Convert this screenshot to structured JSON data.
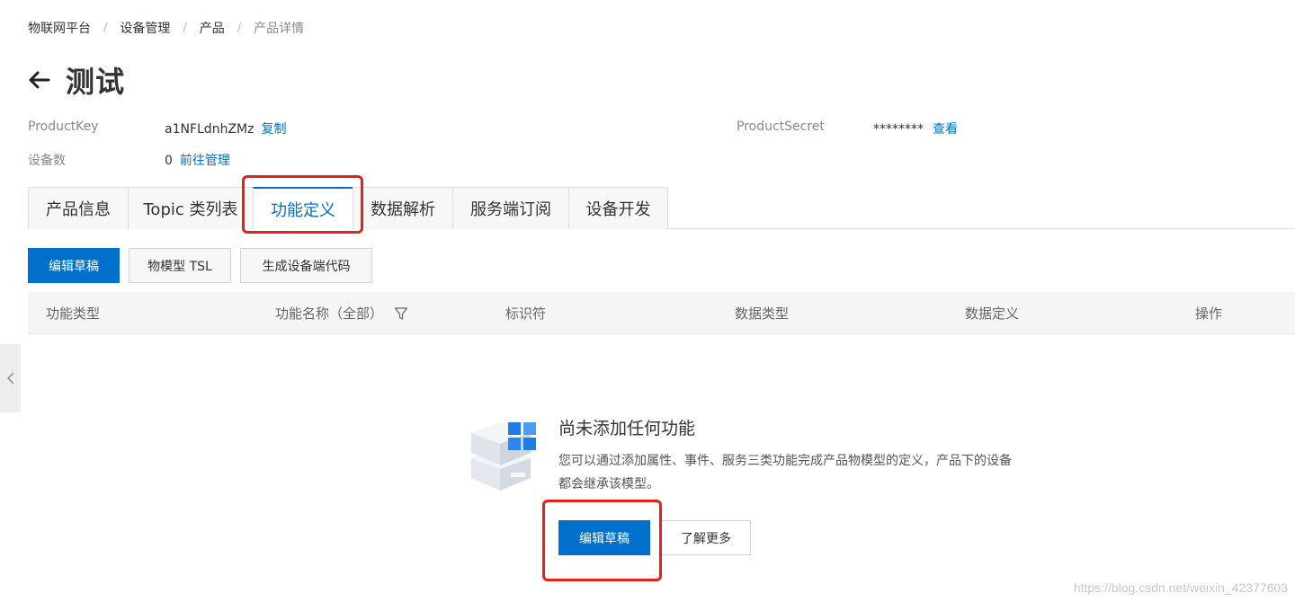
{
  "breadcrumb": {
    "items": [
      "物联网平台",
      "设备管理",
      "产品"
    ],
    "current": "产品详情",
    "separator": "/"
  },
  "header": {
    "title": "测试",
    "back_icon": "arrow-left-icon"
  },
  "meta": {
    "product_key_label": "ProductKey",
    "product_key_value": "a1NFLdnhZMz",
    "copy_link": "复制",
    "device_count_label": "设备数",
    "device_count_value": "0",
    "manage_link": "前往管理",
    "product_secret_label": "ProductSecret",
    "product_secret_value": "********",
    "view_link": "查看"
  },
  "tabs": [
    {
      "label": "产品信息"
    },
    {
      "label": "Topic 类列表"
    },
    {
      "label": "功能定义"
    },
    {
      "label": "数据解析"
    },
    {
      "label": "服务端订阅"
    },
    {
      "label": "设备开发"
    }
  ],
  "active_tab": "功能定义",
  "toolbar": {
    "edit_draft": "编辑草稿",
    "tsl": "物模型 TSL",
    "gen_code": "生成设备端代码"
  },
  "table": {
    "columns": [
      "功能类型",
      "功能名称（全部）",
      "标识符",
      "数据类型",
      "数据定义",
      "操作"
    ]
  },
  "empty_state": {
    "title": "尚未添加任何功能",
    "description": "您可以通过添加属性、事件、服务三类功能完成产品物模型的定义，产品下的设备都会继承该模型。",
    "primary_button": "编辑草稿",
    "secondary_button": "了解更多"
  },
  "watermark": "https://blog.csdn.net/weixin_42377603",
  "colors": {
    "accent": "#0070cc",
    "annotation": "#e2231a"
  }
}
